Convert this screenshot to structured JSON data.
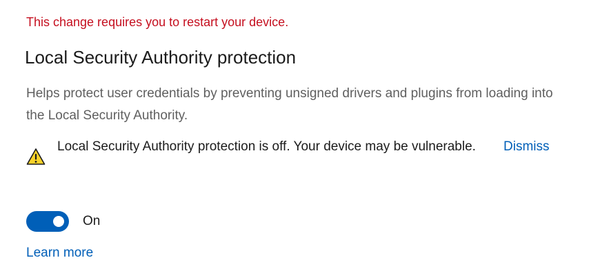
{
  "notice": {
    "restart_text": "This change requires you to restart your device."
  },
  "section": {
    "title": "Local Security Authority protection",
    "description": "Helps protect user credentials by preventing unsigned drivers and plugins from loading into the Local Security Authority."
  },
  "warning": {
    "icon": "warning-triangle-icon",
    "text": "Local Security Authority protection is off. Your device may be vulnerable.",
    "dismiss_label": "Dismiss"
  },
  "toggle": {
    "state": "on",
    "label": "On"
  },
  "links": {
    "learn_more": "Learn more"
  },
  "colors": {
    "error_red": "#c50f1f",
    "accent_blue": "#005fb8",
    "warning_yellow": "#f8d22a",
    "secondary_text": "#5f5f5f"
  }
}
